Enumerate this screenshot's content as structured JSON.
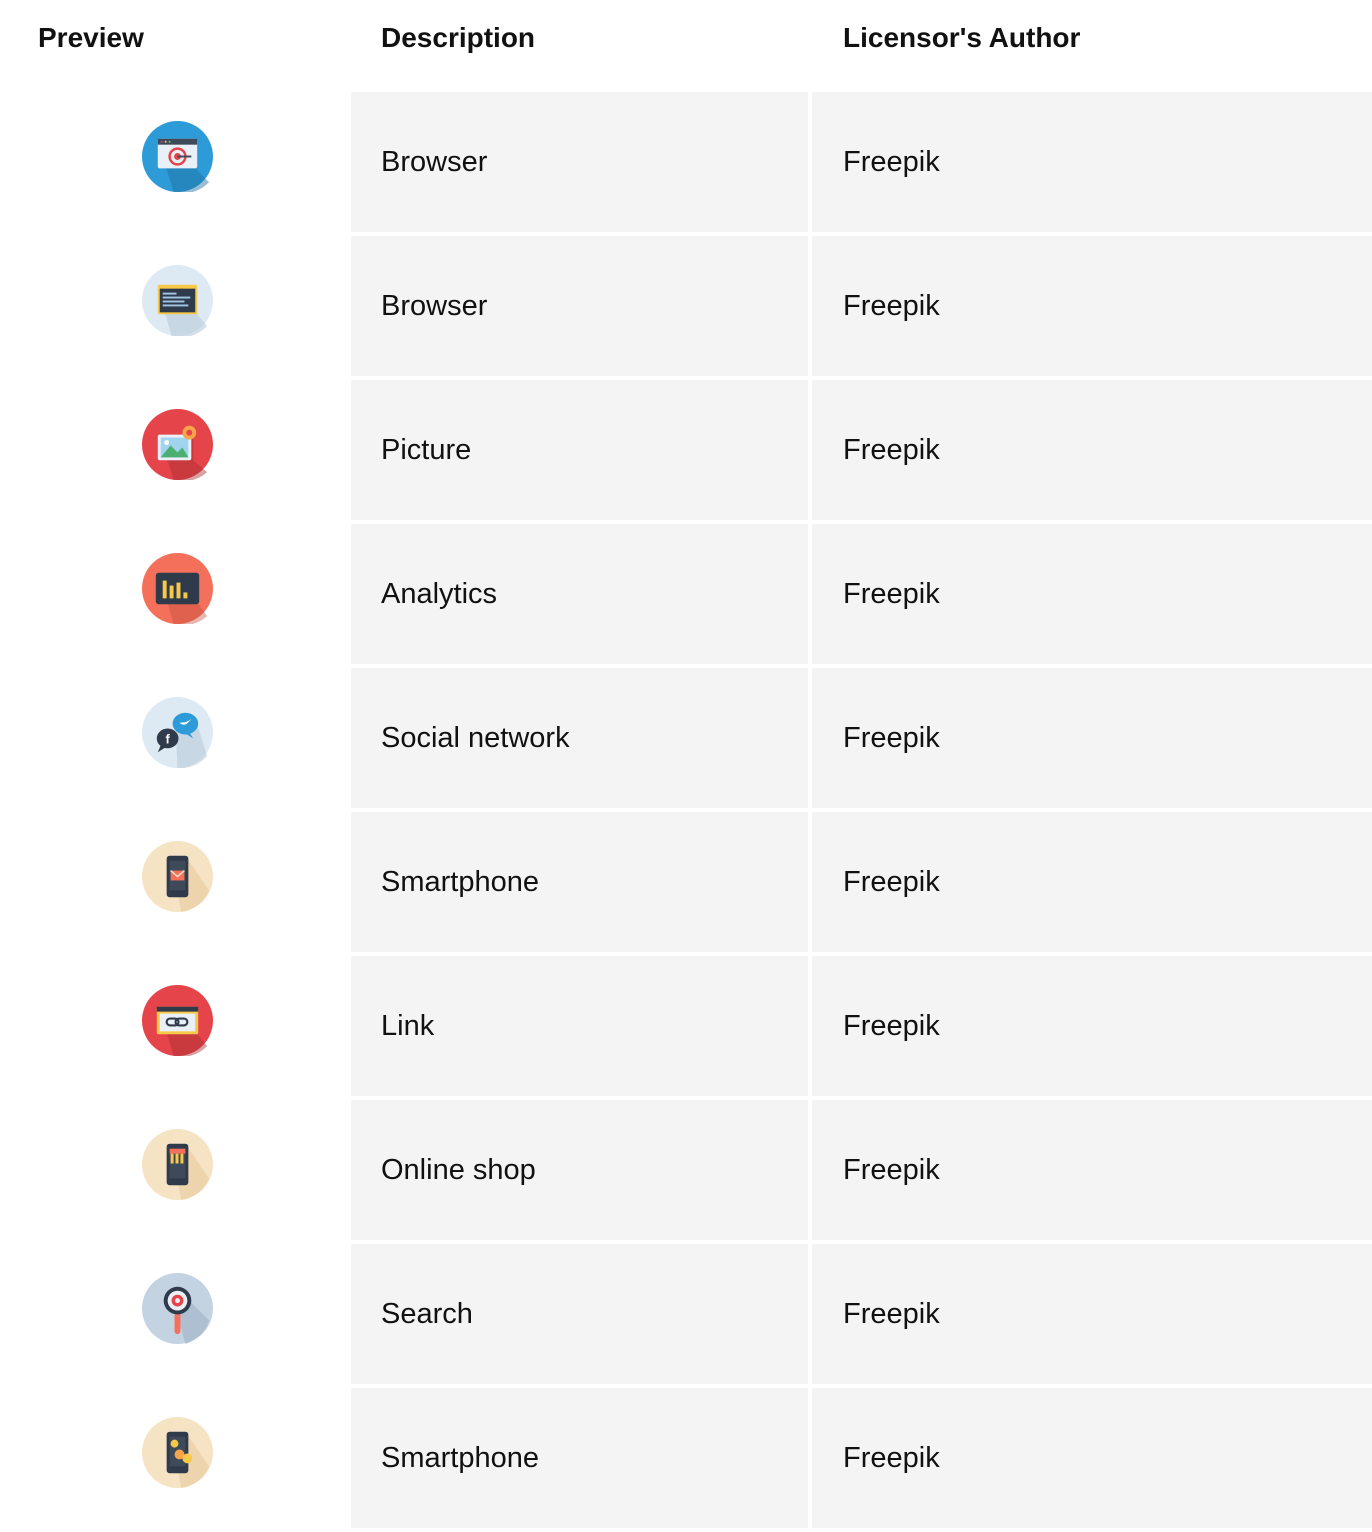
{
  "table": {
    "headers": {
      "preview": "Preview",
      "description": "Description",
      "author": "Licensor's Author"
    },
    "rows": [
      {
        "icon": "browser-target-icon",
        "description": "Browser",
        "author": "Freepik"
      },
      {
        "icon": "browser-code-icon",
        "description": "Browser",
        "author": "Freepik"
      },
      {
        "icon": "picture-settings-icon",
        "description": "Picture",
        "author": "Freepik"
      },
      {
        "icon": "analytics-chart-icon",
        "description": "Analytics",
        "author": "Freepik"
      },
      {
        "icon": "social-network-bubbles-icon",
        "description": "Social network",
        "author": "Freepik"
      },
      {
        "icon": "smartphone-mail-icon",
        "description": "Smartphone",
        "author": "Freepik"
      },
      {
        "icon": "browser-link-icon",
        "description": "Link",
        "author": "Freepik"
      },
      {
        "icon": "online-shop-phone-icon",
        "description": "Online shop",
        "author": "Freepik"
      },
      {
        "icon": "search-magnifier-gear-icon",
        "description": "Search",
        "author": "Freepik"
      },
      {
        "icon": "smartphone-coins-icon",
        "description": "Smartphone",
        "author": "Freepik"
      }
    ]
  },
  "colors": {
    "cell_background": "#f4f4f4",
    "blue": "#2d9bd8",
    "light_blue": "#dde9f3",
    "red": "#e4444a",
    "orange": "#f4705a",
    "peach": "#f6e3c4",
    "gray_blue": "#c3d3e2"
  }
}
